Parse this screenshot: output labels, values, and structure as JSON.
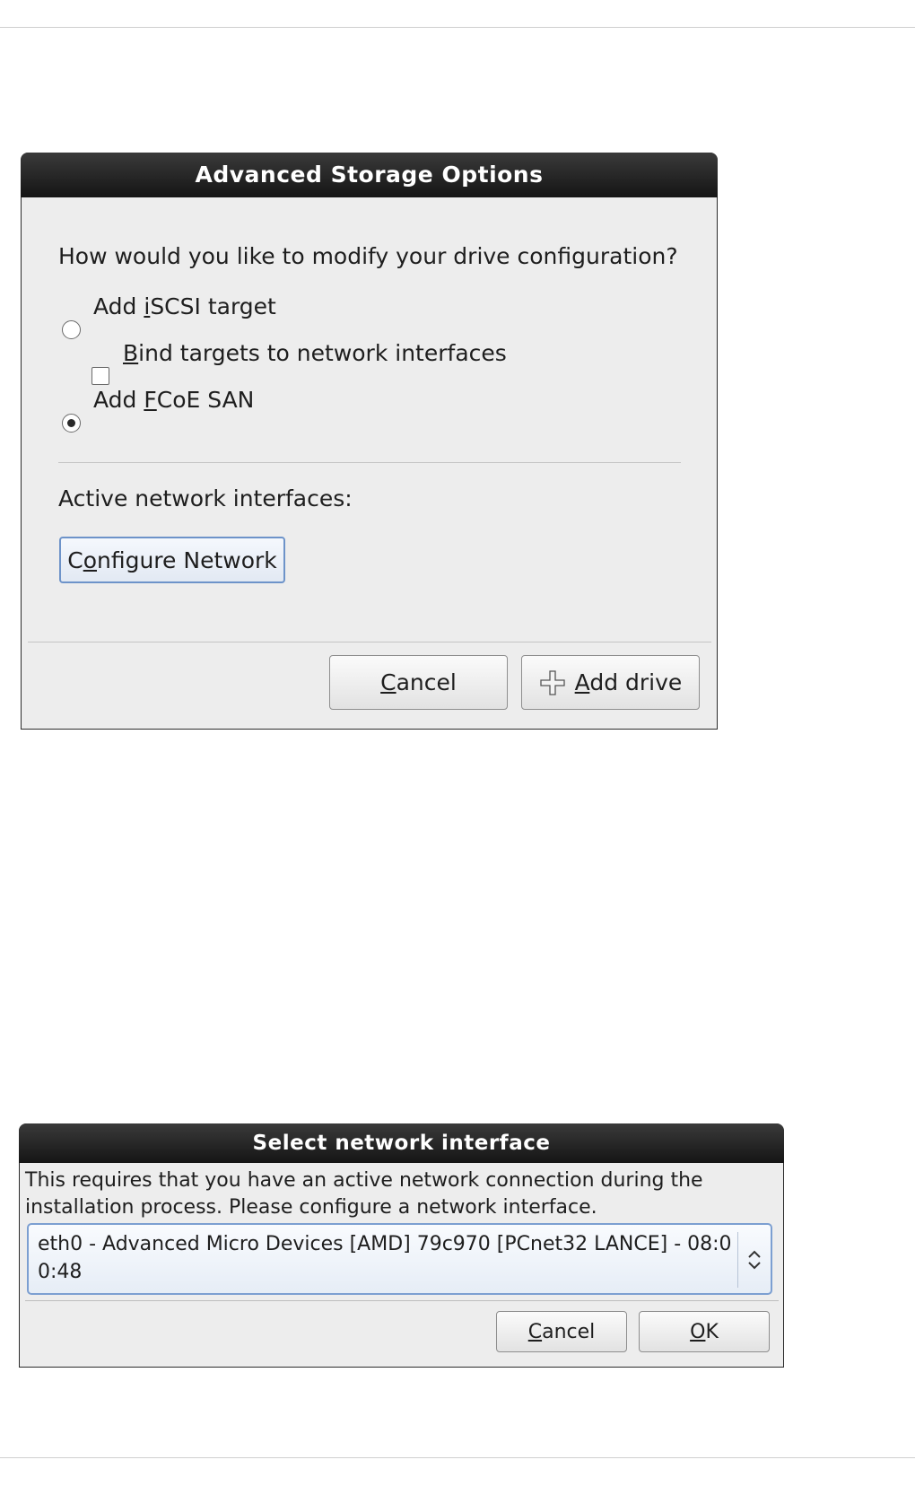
{
  "advanced_storage_dialog": {
    "title": "Advanced Storage Options",
    "question": "How would you like to modify your drive configuration?",
    "options": [
      {
        "label_pre": "Add ",
        "mnemonic": "i",
        "label_post": "SCSI target",
        "selected": false
      },
      {
        "label_pre": "",
        "mnemonic": "B",
        "label_post": "ind targets to network interfaces",
        "checked": false
      },
      {
        "label_pre": "Add ",
        "mnemonic": "F",
        "label_post": "CoE SAN",
        "selected": true
      }
    ],
    "active_interfaces_label": "Active network interfaces:",
    "configure_button": {
      "pre": "C",
      "mnemonic": "o",
      "post": "nfigure Network"
    },
    "cancel_button": {
      "pre": "",
      "mnemonic": "C",
      "post": "ancel"
    },
    "add_drive_button": {
      "pre": "",
      "mnemonic": "A",
      "post": "dd drive",
      "icon": "plus-icon"
    }
  },
  "select_interface_dialog": {
    "title": "Select network interface",
    "description": "This requires that you have an active network connection during the installation process.  Please configure a network interface.",
    "selected_interface": "eth0 - Advanced Micro Devices [AMD] 79c970 [PCnet32 LANCE] - 08:00:48",
    "cancel_button": {
      "pre": "",
      "mnemonic": "C",
      "post": "ancel"
    },
    "ok_button": {
      "pre": "",
      "mnemonic": "O",
      "post": "K"
    }
  }
}
